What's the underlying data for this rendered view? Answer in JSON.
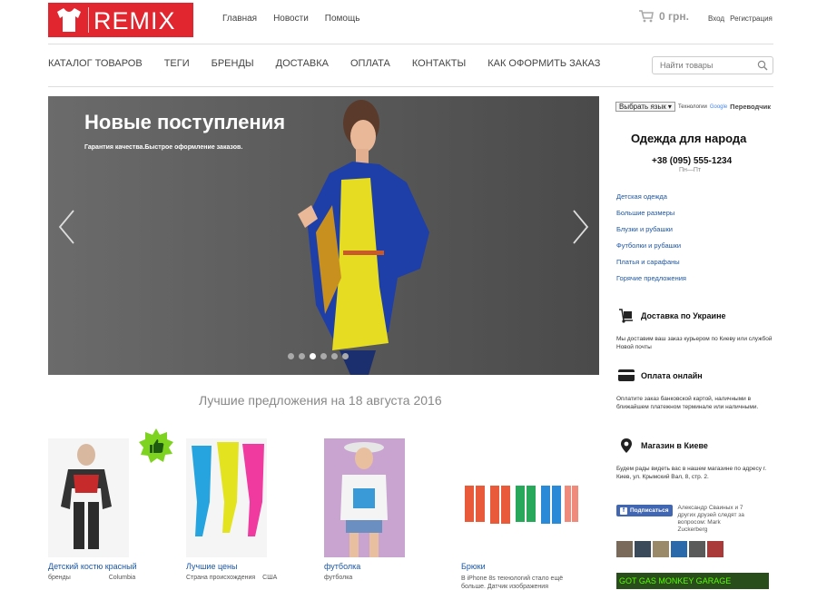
{
  "header": {
    "logo_text": "REMIX",
    "nav": [
      "Главная",
      "Новости",
      "Помощь"
    ],
    "cart_total": "0 грн.",
    "login": "Вход",
    "register": "Регистрация"
  },
  "main_nav": [
    "КАТАЛОГ ТОВАРОВ",
    "ТЕГИ",
    "БРЕНДЫ",
    "ДОСТАВКА",
    "ОПЛАТА",
    "КОНТАКТЫ",
    "КАК ОФОРМИТЬ ЗАКАЗ"
  ],
  "search": {
    "placeholder": "Найти товары"
  },
  "slider": {
    "title": "Новые поступления",
    "subtitle": "Гарантия качества.Быстрое оформление заказов.",
    "dots": 6,
    "active_dot": 3
  },
  "offers": {
    "title": "Лучшие предложения на 18 августа 2016",
    "products": [
      {
        "name": "Детский костю красный",
        "meta_label": "бренды",
        "meta_value": "Columbia"
      },
      {
        "name": "Лучшие цены",
        "meta_label": "Страна происхождения",
        "meta_value": "США"
      },
      {
        "name": "футболка",
        "meta_label": "футболка",
        "meta_value": ""
      },
      {
        "name": "Брюки",
        "meta_label": "В iPhone 8s технологий стало ещё больше. Датчик изображения",
        "meta_value": ""
      }
    ]
  },
  "sidebar": {
    "language_select": "Выбрать язык",
    "translate_label": "Технологии",
    "google": "Google",
    "translator": "Переводчик",
    "tagline": "Одежда для народа",
    "phone": "+38 (095) 555-1234",
    "hours": "Пн—Пт",
    "categories": [
      "Детская одежда",
      "Большие размеры",
      "Блузки и рубашки",
      "Футболки и рубашки",
      "Платья и сарафаны",
      "Горячие предложения"
    ],
    "delivery": {
      "title": "Доставка по Украине",
      "text": "Мы доставим ваш заказ курьером по Киеву или службой Новой почты"
    },
    "payment": {
      "title": "Оплата онлайн",
      "text": "Оплатите заказ банковской картой, наличными в ближайшем платежном терминале или наличными."
    },
    "store": {
      "title": "Магазин в Киеве",
      "text": "Будем рады видеть вас в нашем магазине по адресу г. Киев, ул. Крымский Вал, 8, стр. 2."
    },
    "facebook": {
      "button": "Подписаться",
      "text": "Александр Сваиных и 7 других друзей следят за вопросом: Mark Zuckerberg"
    },
    "banner": "GOT GAS MONKEY GARAGE"
  },
  "colors": {
    "brand_red": "#e2262f",
    "link_blue": "#1a56a6"
  }
}
